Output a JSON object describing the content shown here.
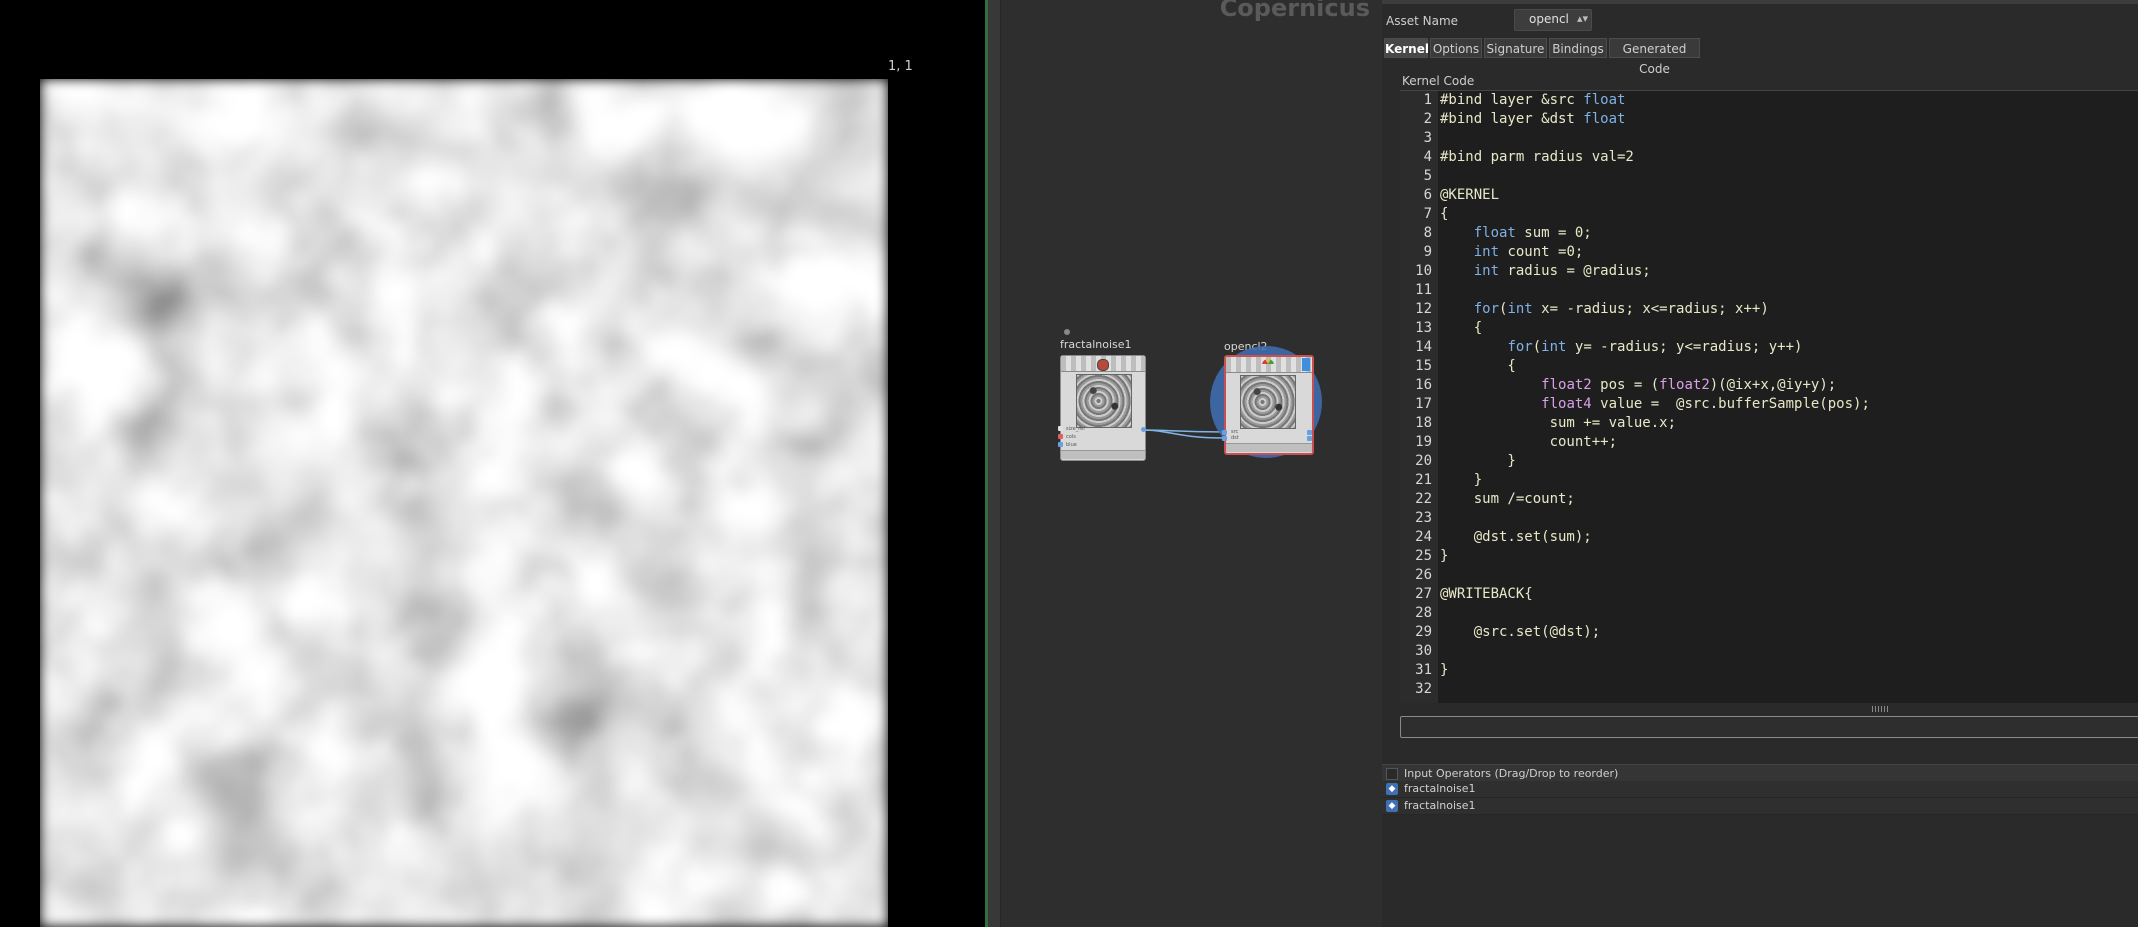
{
  "viewport": {
    "coord_readout": "1, 1"
  },
  "network": {
    "context_label": "Copernicus",
    "nodes": [
      {
        "name": "fractalnoise1",
        "ports": [
          "size_ref",
          "cols",
          "blue"
        ]
      },
      {
        "name": "opencl2",
        "ports": [
          "src",
          "dst"
        ]
      }
    ]
  },
  "params": {
    "asset_name_label": "Asset Name",
    "asset_name_value": "opencl",
    "tabs": [
      "Kernel",
      "Options",
      "Signature",
      "Bindings",
      "Generated Code"
    ],
    "active_tab": "Kernel",
    "kernel_code_label": "Kernel Code",
    "code_lines": [
      "#bind layer &src float",
      "#bind layer &dst float",
      "",
      "#bind parm radius val=2",
      "",
      "@KERNEL",
      "{",
      "    float sum = 0;",
      "    int count =0;",
      "    int radius = @radius;",
      "",
      "    for(int x= -radius; x<=radius; x++)",
      "    {",
      "        for(int y= -radius; y<=radius; y++)",
      "        {",
      "            float2 pos = (float2)(@ix+x,@iy+y);",
      "            float4 value =  @src.bufferSample(pos);",
      "             sum += value.x;",
      "             count++;",
      "        }",
      "    }",
      "    sum /=count;",
      "",
      "    @dst.set(sum);",
      "}",
      "",
      "@WRITEBACK{",
      "",
      "    @src.set(@dst);",
      "",
      "}",
      ""
    ],
    "input_operators_label": "Input Operators (Drag/Drop to reorder)",
    "input_operators": [
      "fractalnoise1",
      "fractalnoise1"
    ]
  },
  "colors": {
    "accent": "#3f6fb5",
    "code_text": "#e8e8c8",
    "keyword": "#7fb0e6",
    "type": "#d9a0e8"
  }
}
